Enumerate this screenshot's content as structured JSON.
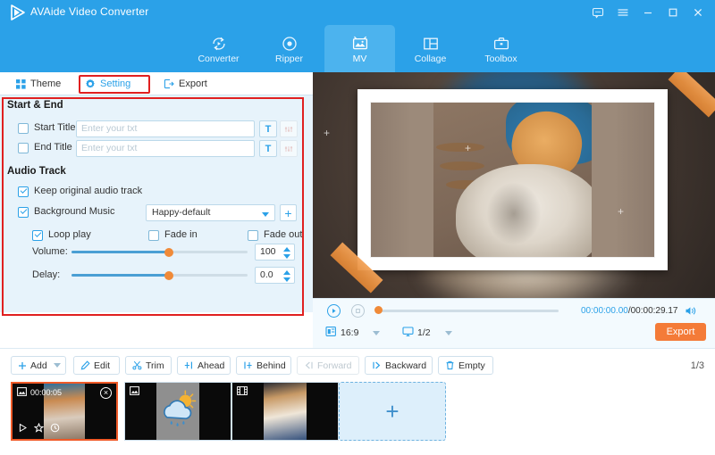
{
  "window": {
    "app_title": "AVAide Video Converter",
    "controls": [
      {
        "name": "feedback-icon",
        "label": "Feedback"
      },
      {
        "name": "menu-icon",
        "label": "Menu"
      },
      {
        "name": "minimize-icon",
        "label": "Minimize"
      },
      {
        "name": "maximize-icon",
        "label": "Maximize"
      },
      {
        "name": "close-icon",
        "label": "Close"
      }
    ]
  },
  "nav": {
    "tabs": [
      {
        "label": "Converter",
        "icon": "convert-icon",
        "active": false
      },
      {
        "label": "Ripper",
        "icon": "disc-icon",
        "active": false
      },
      {
        "label": "MV",
        "icon": "mv-icon",
        "active": true
      },
      {
        "label": "Collage",
        "icon": "collage-icon",
        "active": false
      },
      {
        "label": "Toolbox",
        "icon": "toolbox-icon",
        "active": false
      }
    ]
  },
  "subtabs": {
    "theme": "Theme",
    "setting": "Setting",
    "export": "Export",
    "active": "Setting"
  },
  "settings": {
    "start_end": {
      "title": "Start & End",
      "start_title": {
        "label": "Start Title",
        "checked": false,
        "value": "",
        "placeholder": "Enter your txt",
        "text_button": "T"
      },
      "end_title": {
        "label": "End Title",
        "checked": false,
        "value": "",
        "placeholder": "Enter your txt",
        "text_button": "T"
      }
    },
    "audio_track": {
      "title": "Audio Track",
      "keep_original": {
        "label": "Keep original audio track",
        "checked": true
      },
      "background_music": {
        "label": "Background Music",
        "checked": true
      },
      "music_select": {
        "value": "Happy-default",
        "add_label": "+"
      },
      "loop_play": {
        "label": "Loop play",
        "checked": true
      },
      "fade_in": {
        "label": "Fade in",
        "checked": false
      },
      "fade_out": {
        "label": "Fade out",
        "checked": false
      },
      "volume": {
        "label": "Volume:",
        "value": "100",
        "percent": 55
      },
      "delay": {
        "label": "Delay:",
        "value": "0.0",
        "percent": 55
      }
    }
  },
  "player": {
    "play_label": "Play",
    "stop_label": "Stop",
    "current_time": "00:00:00.00",
    "separator": "/",
    "total_time": "00:00:29.17",
    "volume_icon": "speaker-icon",
    "aspect_ratio": "16:9",
    "zoom_level": "1/2",
    "export_label": "Export",
    "progress_percent": 0
  },
  "toolbar": {
    "buttons": [
      {
        "label": "Add",
        "icon": "plus-icon",
        "disabled": false,
        "has_dropdown": true
      },
      {
        "label": "Edit",
        "icon": "edit-icon",
        "disabled": false,
        "has_dropdown": false
      },
      {
        "label": "Trim",
        "icon": "scissors-icon",
        "disabled": false,
        "has_dropdown": false
      },
      {
        "label": "Ahead",
        "icon": "insert-before-icon",
        "disabled": false,
        "has_dropdown": false
      },
      {
        "label": "Behind",
        "icon": "insert-after-icon",
        "disabled": false,
        "has_dropdown": false
      },
      {
        "label": "Forward",
        "icon": "move-left-icon",
        "disabled": true,
        "has_dropdown": false
      },
      {
        "label": "Backward",
        "icon": "move-right-icon",
        "disabled": false,
        "has_dropdown": false
      },
      {
        "label": "Empty",
        "icon": "trash-icon",
        "disabled": false,
        "has_dropdown": false
      }
    ],
    "page_indicator": "1/3"
  },
  "thumbnails": [
    {
      "duration": "00:00:05",
      "selected": true,
      "type": "video",
      "badge_icon": "image-icon",
      "close_label": "×"
    },
    {
      "duration": "",
      "selected": false,
      "type": "image",
      "badge_icon": "image-icon",
      "close_label": ""
    },
    {
      "duration": "",
      "selected": false,
      "type": "video",
      "badge_icon": "film-icon",
      "close_label": ""
    }
  ],
  "add_tile": {
    "label": "+"
  },
  "colors": {
    "brand_blue": "#2ba1e8",
    "panel_blue": "#e7f3fb",
    "accent_orange": "#f47b38",
    "slider_orange": "#f08a38",
    "annotation_red": "#e02020",
    "selected_border": "#f05a28"
  }
}
